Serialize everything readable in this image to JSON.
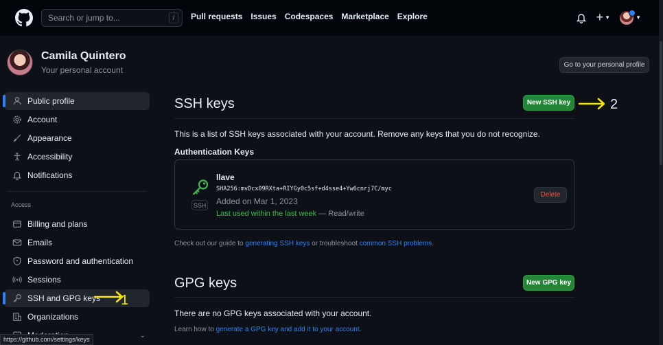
{
  "topbar": {
    "search_placeholder": "Search or jump to...",
    "search_shortcut": "/",
    "nav": [
      "Pull requests",
      "Issues",
      "Codespaces",
      "Marketplace",
      "Explore"
    ],
    "plus": "+"
  },
  "profile": {
    "name": "Camila Quintero",
    "subtitle": "Your personal account",
    "button": "Go to your personal profile"
  },
  "sidebar": {
    "items_top": [
      {
        "label": "Public profile",
        "icon": "person-icon"
      },
      {
        "label": "Account",
        "icon": "gear-icon"
      },
      {
        "label": "Appearance",
        "icon": "paintbrush-icon"
      },
      {
        "label": "Accessibility",
        "icon": "accessibility-icon"
      },
      {
        "label": "Notifications",
        "icon": "bell-icon"
      }
    ],
    "section_access": "Access",
    "items_access": [
      {
        "label": "Billing and plans",
        "icon": "billing-icon"
      },
      {
        "label": "Emails",
        "icon": "mail-icon"
      },
      {
        "label": "Password and authentication",
        "icon": "shield-icon"
      },
      {
        "label": "Sessions",
        "icon": "broadcast-icon"
      },
      {
        "label": "SSH and GPG keys",
        "icon": "key-icon"
      },
      {
        "label": "Organizations",
        "icon": "organization-icon"
      },
      {
        "label": "Moderation",
        "icon": "report-icon"
      }
    ]
  },
  "ssh": {
    "title": "SSH keys",
    "new_button": "New SSH key",
    "description": "This is a list of SSH keys associated with your account. Remove any keys that you do not recognize.",
    "auth_heading": "Authentication Keys",
    "key": {
      "name": "llave",
      "fingerprint": "SHA256:mvDcx09RXta+RIYGy0c5sf+d4sse4+Yw6cnrj7C/myc",
      "added": "Added on Mar 1, 2023",
      "last_used": "Last used within the last week",
      "access": "— Read/write",
      "tag": "SSH",
      "delete": "Delete"
    },
    "guide_prefix": "Check out our guide to ",
    "guide_link1": "generating SSH keys",
    "guide_mid": " or troubleshoot ",
    "guide_link2": "common SSH problems",
    "guide_suffix": "."
  },
  "gpg": {
    "title": "GPG keys",
    "new_button": "New GPG key",
    "none_text": "There are no GPG keys associated with your account.",
    "learn_prefix": "Learn how to ",
    "learn_link": "generate a GPG key and add it to your account",
    "learn_suffix": "."
  },
  "annotations": {
    "one": "1",
    "two": "2",
    "color": "#ffe600"
  },
  "status_url": "https://github.com/settings/keys",
  "colors": {
    "accent": "#2f81f7",
    "green_button": "#238636",
    "danger": "#f85149",
    "success_text": "#3fb950"
  }
}
